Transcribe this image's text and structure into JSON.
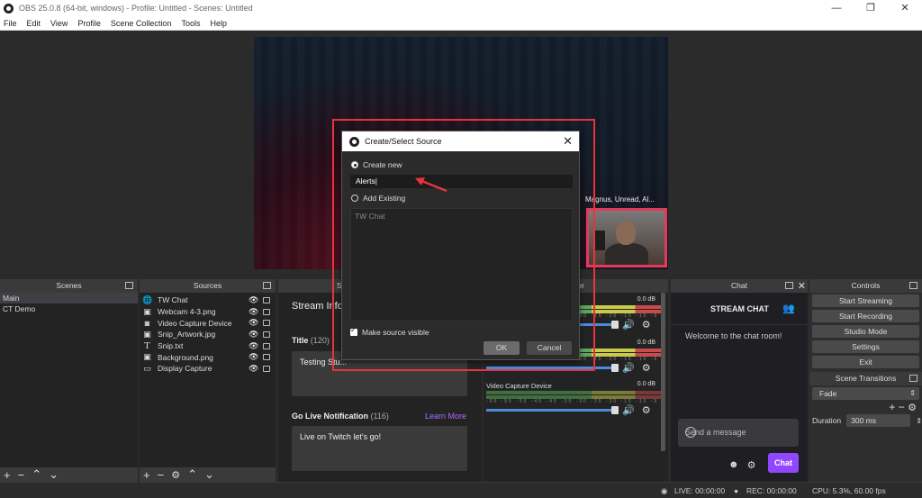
{
  "window": {
    "title": "OBS 25.0.8 (64-bit, windows) - Profile: Untitled - Scenes: Untitled",
    "controls": [
      "—",
      "❐",
      "✕"
    ]
  },
  "menu": [
    "File",
    "Edit",
    "View",
    "Profile",
    "Scene Collection",
    "Tools",
    "Help"
  ],
  "preview": {
    "chat_overlay_text": "Magnus, Unread, Al..."
  },
  "scenes": {
    "header": "Scenes",
    "items": [
      "Main",
      "CT Demo"
    ],
    "selected": "Main"
  },
  "sources": {
    "header": "Sources",
    "items": [
      {
        "label": "TW Chat",
        "icon": "globe-icon",
        "glyph": "🌐"
      },
      {
        "label": "Webcam 4-3.png",
        "icon": "image-icon",
        "glyph": "▣"
      },
      {
        "label": "Video Capture Device",
        "icon": "camera-icon",
        "glyph": "◙"
      },
      {
        "label": "Snip_Artwork.jpg",
        "icon": "image-icon",
        "glyph": "▣"
      },
      {
        "label": "Snip.txt",
        "icon": "text-icon",
        "glyph": "T"
      },
      {
        "label": "Background.png",
        "icon": "image-icon",
        "glyph": "▣"
      },
      {
        "label": "Display Capture",
        "icon": "monitor-icon",
        "glyph": "▭"
      }
    ]
  },
  "stream_info": {
    "header": "S",
    "heading": "Stream Info",
    "title_label": "Title",
    "title_count": "(120)",
    "title_value": "Testing Stu...",
    "notification_label": "Go Live Notification",
    "notification_count": "(116)",
    "learn_more": "Learn More",
    "notification_value": "Live on Twitch let's go!"
  },
  "mixer": {
    "header": "xer",
    "db_values": [
      "0.0 dB",
      "0.0 dB",
      "0.0 dB"
    ],
    "scale": "-60 -55 -50 -45 -40 -35 -30 -25 -20 -15 -10 -5 0",
    "channel_name": "Video Capture Device"
  },
  "chat": {
    "header": "Chat",
    "title": "STREAM CHAT",
    "welcome": "Welcome to the chat room!",
    "input_placeholder": "Send a message",
    "send_button": "Chat"
  },
  "controls": {
    "header": "Controls",
    "buttons": [
      "Start Streaming",
      "Start Recording",
      "Studio Mode",
      "Settings",
      "Exit"
    ]
  },
  "scene_transitions": {
    "header": "Scene Transitions",
    "transition": "Fade",
    "duration_label": "Duration",
    "duration_value": "300 ms"
  },
  "statusbar": {
    "live": "LIVE: 00:00:00",
    "rec": "REC: 00:00:00",
    "cpu": "CPU: 5.3%, 60.00 fps"
  },
  "dialog": {
    "title": "Create/Select Source",
    "create_new_label": "Create new",
    "name_value": "Alerts",
    "add_existing_label": "Add Existing",
    "existing_items": [
      "TW Chat"
    ],
    "make_visible_label": "Make source visible",
    "ok_label": "OK",
    "cancel_label": "Cancel"
  },
  "colors": {
    "accent_purple": "#9147ff",
    "highlight_red": "#e8333d",
    "slider_blue": "#4a8be0"
  }
}
